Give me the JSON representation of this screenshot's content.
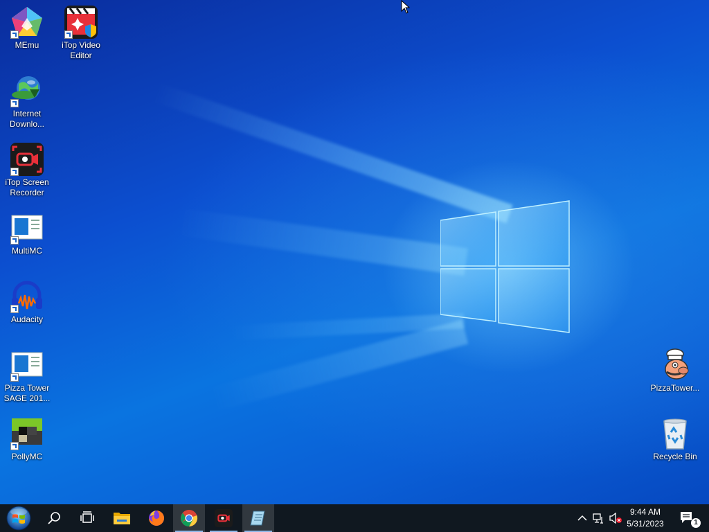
{
  "desktop": {
    "icons_left": [
      {
        "label": "MEmu"
      },
      {
        "label": "iTop Video Editor"
      },
      {
        "label": "Internet Downlo..."
      },
      {
        "label": "iTop Screen Recorder"
      },
      {
        "label": "MultiMC"
      },
      {
        "label": "Audacity"
      },
      {
        "label": "Pizza Tower SAGE 201..."
      },
      {
        "label": "PollyMC"
      }
    ],
    "icons_right": [
      {
        "label": "PizzaTower..."
      },
      {
        "label": "Recycle Bin"
      }
    ]
  },
  "taskbar": {
    "buttons": [
      {
        "icon": "start-orb-icon"
      },
      {
        "icon": "search-icon"
      },
      {
        "icon": "task-view-icon"
      },
      {
        "icon": "file-explorer-icon"
      },
      {
        "icon": "firefox-icon"
      },
      {
        "icon": "chrome-icon"
      },
      {
        "icon": "itop-screen-recorder-icon"
      },
      {
        "icon": "notepad-icon"
      }
    ],
    "tray": {
      "time": "9:44 AM",
      "date": "5/31/2023",
      "notification_count": "1"
    }
  },
  "colors": {
    "taskbar_bg": "#101820",
    "desktop_blue": "#0a74e0"
  }
}
